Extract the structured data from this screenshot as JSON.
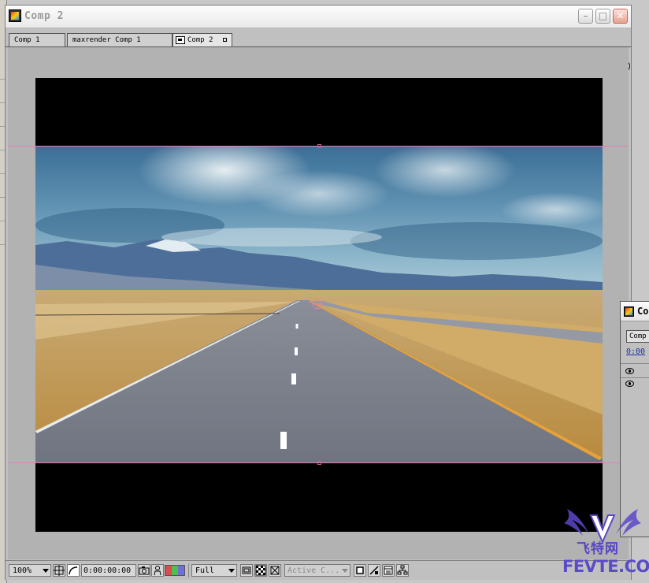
{
  "window": {
    "title": "Comp 2",
    "minimize_symbol": "–",
    "maximize_symbol": "□",
    "close_symbol": "✕"
  },
  "tabs": [
    {
      "label": "Comp 1"
    },
    {
      "label": "maxrender Comp 1"
    },
    {
      "label": "Comp 2"
    }
  ],
  "tab_menu_symbol": "▶",
  "statusbar": {
    "zoom": "100%",
    "timecode": "0:00:00:00",
    "resolution": "Full",
    "view": "Active C...",
    "colors": {
      "red": "#d84c4c",
      "green": "#4cbf4c",
      "blue": "#6f6fd8"
    }
  },
  "side_panel": {
    "title": "Co",
    "tab": "Comp",
    "timecode": "0:00"
  },
  "watermark": {
    "cn": "飞特网",
    "en": "FEVTE.COM"
  },
  "icons": {
    "app": "ae-comp-icon",
    "snapshot": "camera-icon",
    "region": "region-of-interest-icon",
    "transparency": "checkerboard-icon",
    "mask": "mask-icon",
    "channels": "rgb-channel-icon",
    "fast_preview": "fast-preview-icon",
    "timeline": "timeline-icon",
    "flowchart": "flowchart-icon"
  }
}
